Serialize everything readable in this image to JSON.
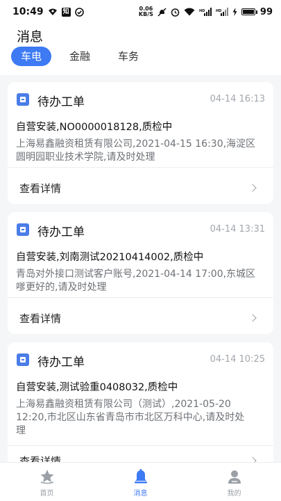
{
  "status_bar": {
    "time": "10:49",
    "left_icons": [
      "signal-dot-icon",
      "app-zhi-icon",
      "check-circle-icon"
    ],
    "app_zhi_glyph": "知",
    "net_speed_value": "0.06",
    "net_speed_unit": "KB/S",
    "right_icons": [
      "mute-icon",
      "alarm-icon",
      "wifi-icon",
      "hd-signal-icon",
      "hd-signal-icon-2",
      "charging-icon"
    ],
    "signal_label": "HD",
    "battery_level": "99",
    "battery_fill": 0.99
  },
  "header": {
    "title": "消息",
    "tabs": [
      {
        "label": "车电",
        "active": true
      },
      {
        "label": "金融",
        "active": false
      },
      {
        "label": "车务",
        "active": false
      }
    ]
  },
  "messages": [
    {
      "icon": "document-icon",
      "title": "待办工单",
      "time": "04-14 16:13",
      "subject": "自营安装,NO0000018128,质检中",
      "desc_line1": "上海易鑫融资租赁有限公司,2021-04-15 16:30,海淀区",
      "desc_line2": "圆明园职业技术学院,请及时处理",
      "desc_line3": "",
      "link": "查看详情"
    },
    {
      "icon": "document-icon",
      "title": "待办工单",
      "time": "04-14 13:31",
      "subject": "自营安装,刘南测试20210414002,质检中",
      "desc_line1": "青岛对外接口测试客户账号,2021-04-14 17:00,东城区",
      "desc_line2": "嗲更好的,请及时处理",
      "desc_line3": "",
      "link": "查看详情"
    },
    {
      "icon": "document-icon",
      "title": "待办工单",
      "time": "04-14 10:25",
      "subject": "自营安装,测试验重0408032,质检中",
      "desc_line1": "上海易鑫融资租赁有限公司（测试）,2021-05-20",
      "desc_line2": "12:20,市北区山东省青岛市市北区万科中心,请及时处",
      "desc_line3": "理",
      "link": "查看详情"
    }
  ],
  "bottom_nav": [
    {
      "label": "首页",
      "icon": "home-star-icon",
      "active": false
    },
    {
      "label": "消息",
      "icon": "bell-icon",
      "active": true
    },
    {
      "label": "我的",
      "icon": "profile-icon",
      "active": false
    }
  ],
  "colors": {
    "accent": "#3d7af3",
    "icon_blue": "#4a7de8",
    "background": "#f4f6f8",
    "muted_text": "#a3a7ad"
  }
}
